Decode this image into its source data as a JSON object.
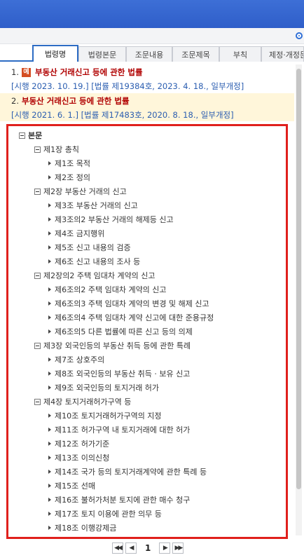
{
  "tabs": [
    {
      "label": "법령명",
      "active": true
    },
    {
      "label": "법령본문"
    },
    {
      "label": "조문내용"
    },
    {
      "label": "조문제목"
    },
    {
      "label": "부칙"
    },
    {
      "label": "제정·개정문"
    }
  ],
  "results": [
    {
      "num": "1.",
      "badge": "예",
      "title": "부동산 거래신고 등에 관한 법률",
      "meta": "[시행 2023. 10. 19.] [법률 제19384호, 2023. 4. 18., 일부개정]"
    },
    {
      "num": "2.",
      "title": "부동산 거래신고 등에 관한 법률",
      "meta": "[시행 2021. 6. 1.] [법률 제17483호, 2020. 8. 18., 일부개정]"
    }
  ],
  "tree": {
    "root": "본문",
    "chapters": [
      {
        "label": "제1장 총칙",
        "articles": [
          "제1조 목적",
          "제2조 정의"
        ]
      },
      {
        "label": "제2장 부동산 거래의 신고",
        "articles": [
          "제3조 부동산 거래의 신고",
          "제3조의2 부동산 거래의 해제등 신고",
          "제4조 금지행위",
          "제5조 신고 내용의 검증",
          "제6조 신고 내용의 조사 등"
        ]
      },
      {
        "label": "제2장의2 주택 임대차 계약의 신고",
        "articles": [
          "제6조의2 주택 임대차 계약의 신고",
          "제6조의3 주택 임대차 계약의 변경 및 해제 신고",
          "제6조의4 주택 임대차 계약 신고에 대한 준용규정",
          "제6조의5 다른 법률에 따른 신고 등의 의제"
        ]
      },
      {
        "label": "제3장 외국인등의 부동산 취득 등에 관한 특례",
        "articles": [
          "제7조 상호주의",
          "제8조 외국인등의 부동산 취득 · 보유 신고",
          "제9조 외국인등의 토지거래 허가"
        ]
      },
      {
        "label": "제4장 토지거래허가구역 등",
        "articles": [
          "제10조 토지거래허가구역의 지정",
          "제11조 허가구역 내 토지거래에 대한 허가",
          "제12조 허가기준",
          "제13조 이의신청",
          "제14조 국가 등의 토지거래계약에 관한 특례 등",
          "제15조 선매",
          "제16조 불허가처분 토지에 관한 매수 청구",
          "제17조 토지 이용에 관한 의무 등",
          "제18조 이행강제금"
        ]
      }
    ]
  },
  "pager": {
    "first": "◀◀",
    "prev": "◀",
    "current": "1",
    "next": "▶",
    "last": "▶▶"
  }
}
